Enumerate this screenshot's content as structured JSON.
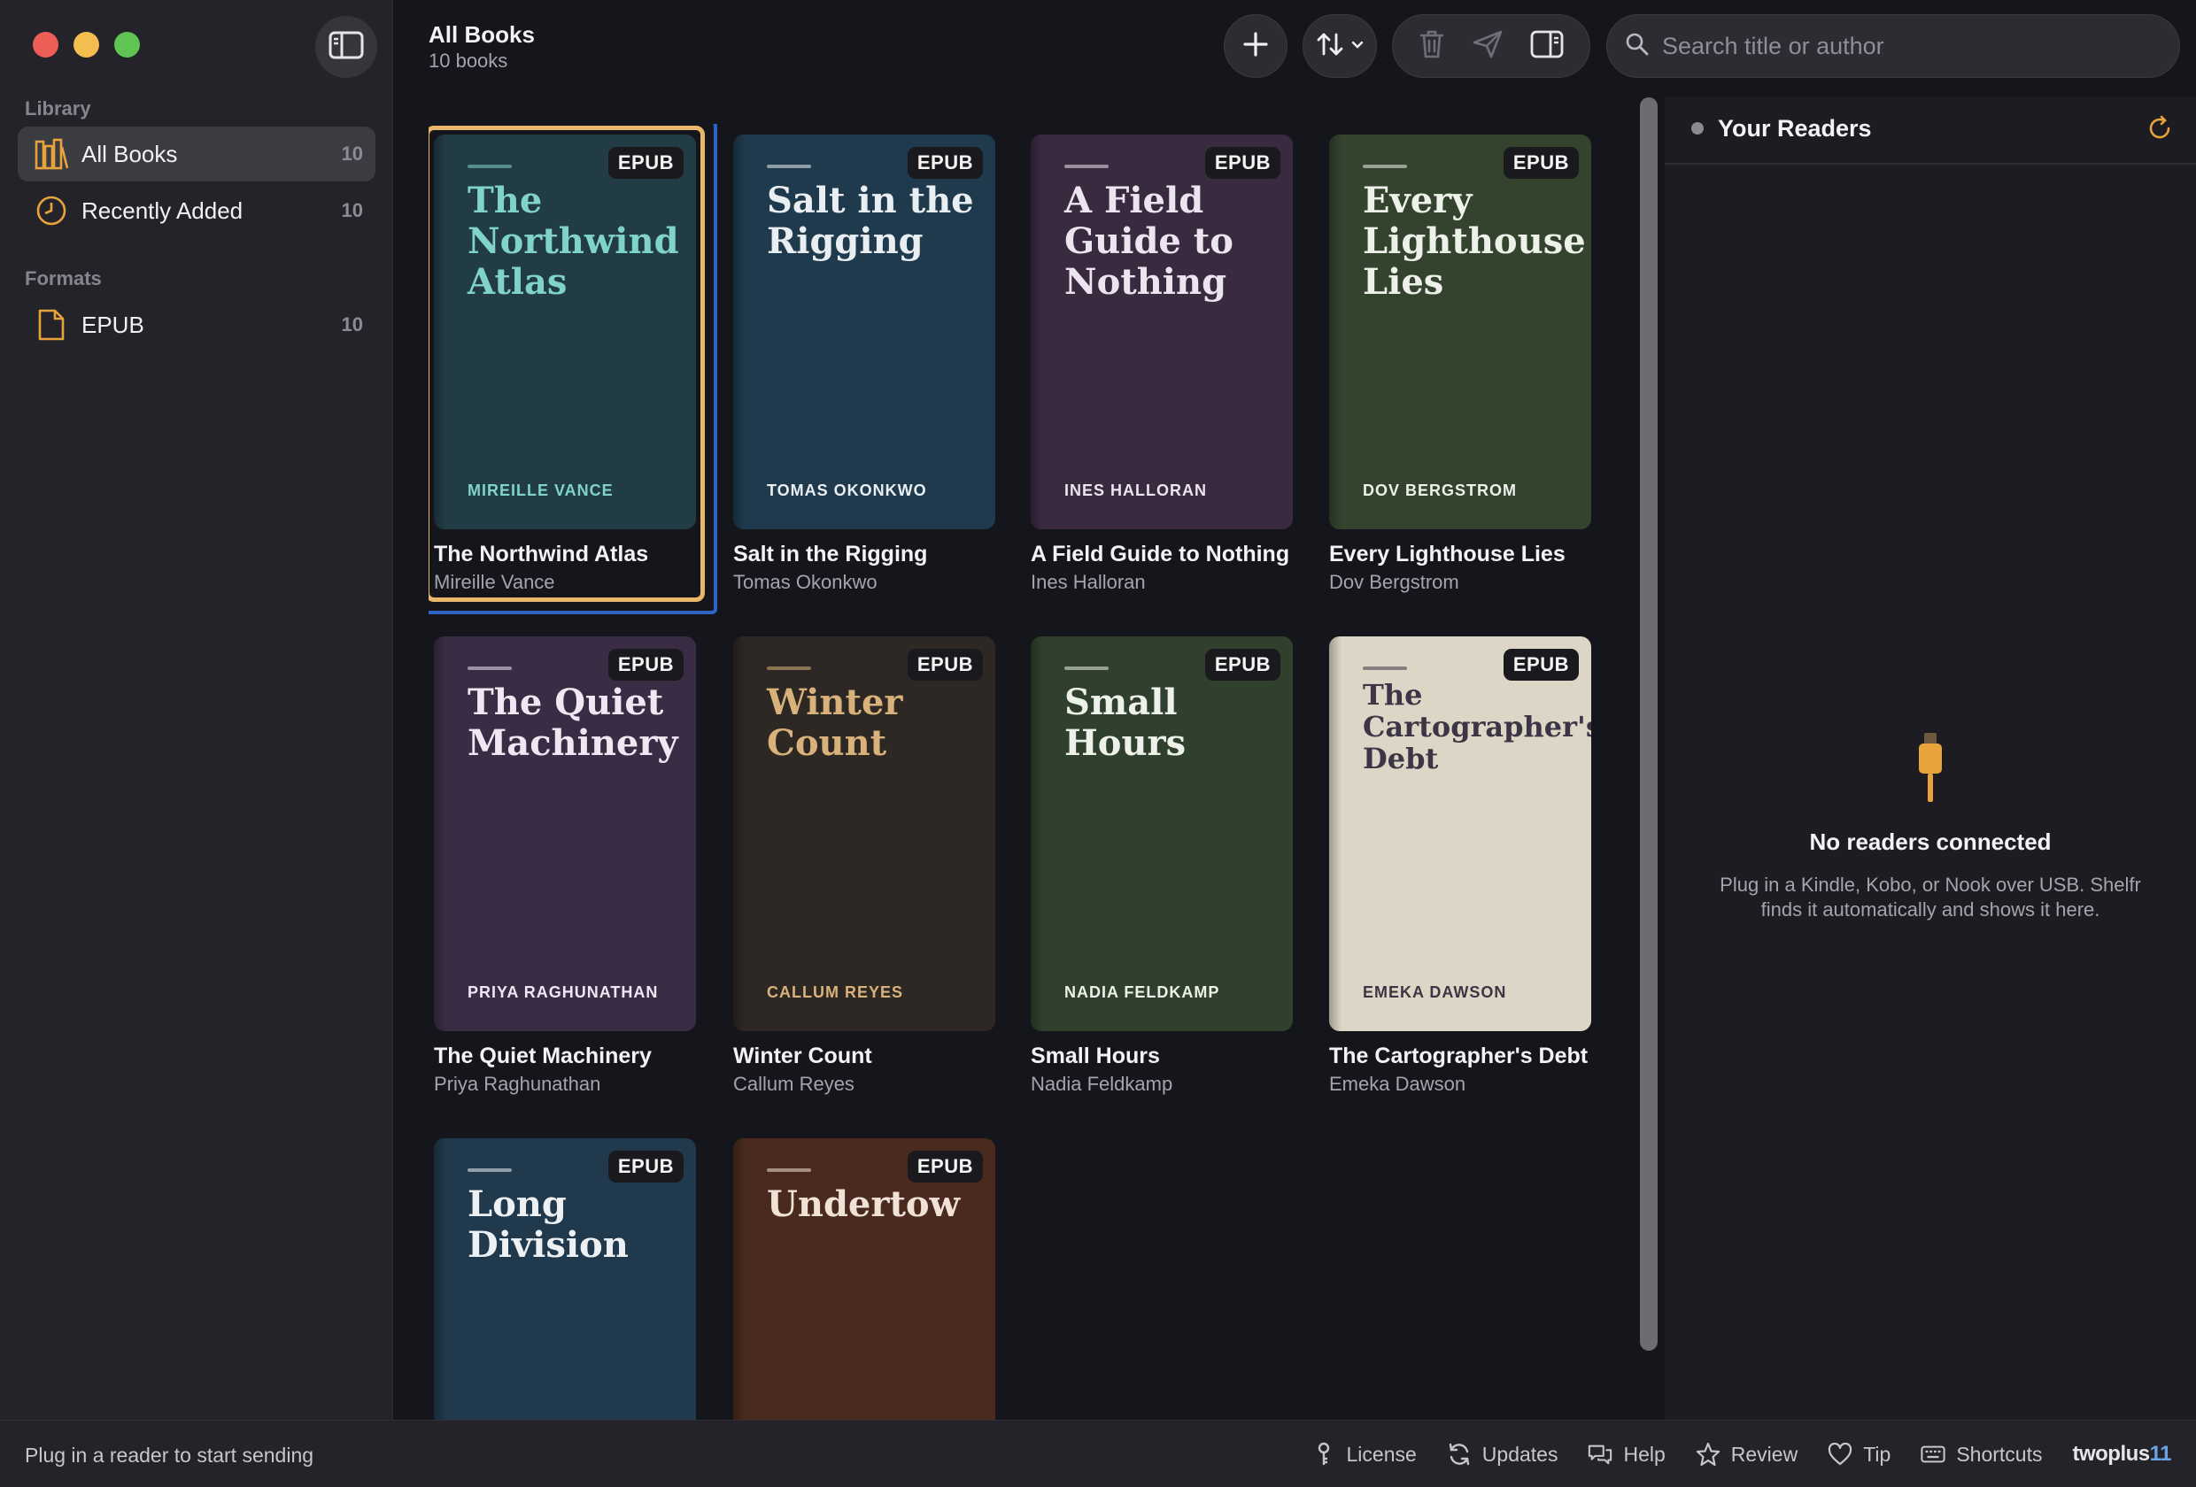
{
  "header": {
    "title": "All Books",
    "subtitle": "10 books",
    "search_placeholder": "Search title or author"
  },
  "sidebar": {
    "library_label": "Library",
    "formats_label": "Formats",
    "items": [
      {
        "label": "All Books",
        "count": "10"
      },
      {
        "label": "Recently Added",
        "count": "10"
      }
    ],
    "formats": [
      {
        "label": "EPUB",
        "count": "10"
      }
    ]
  },
  "books": [
    {
      "title": "The Northwind Atlas",
      "cover_title": "The Northwind Atlas",
      "author": "Mireille Vance",
      "cover_author": "MIREILLE VANCE",
      "format": "EPUB",
      "cover_bg": "#223c45",
      "accent": "#7fd3c8"
    },
    {
      "title": "Salt in the Rigging",
      "cover_title": "Salt in the Rigging",
      "author": "Tomas Okonkwo",
      "cover_author": "TOMAS OKONKWO",
      "format": "EPUB",
      "cover_bg": "#1f3a4d",
      "accent": "#e9eef3"
    },
    {
      "title": "A Field Guide to Nothing",
      "cover_title": "A Field Guide to Nothing",
      "author": "Ines Halloran",
      "cover_author": "INES HALLORAN",
      "format": "EPUB",
      "cover_bg": "#3a2a40",
      "accent": "#ece4ef"
    },
    {
      "title": "Every Lighthouse Lies",
      "cover_title": "Every Lighthouse Lies",
      "author": "Dov Bergstrom",
      "cover_author": "DOV BERGSTROM",
      "format": "EPUB",
      "cover_bg": "#33432e",
      "accent": "#eef1ea"
    },
    {
      "title": "The Quiet Machinery",
      "cover_title": "The Quiet Machinery",
      "author": "Priya Raghunathan",
      "cover_author": "PRIYA RAGHUNATHAN",
      "format": "EPUB",
      "cover_bg": "#3b2c45",
      "accent": "#efe7f2"
    },
    {
      "title": "Winter Count",
      "cover_title": "Winter Count",
      "author": "Callum Reyes",
      "cover_author": "CALLUM REYES",
      "format": "EPUB",
      "cover_bg": "#2e2824",
      "accent": "#d8b27a"
    },
    {
      "title": "Small Hours",
      "cover_title": "Small Hours",
      "author": "Nadia Feldkamp",
      "cover_author": "NADIA FELDKAMP",
      "format": "EPUB",
      "cover_bg": "#2f412d",
      "accent": "#eef1ea"
    },
    {
      "title": "The Cartographer's Debt",
      "cover_title": "The Cartographer's Debt",
      "author": "Emeka Dawson",
      "cover_author": "EMEKA DAWSON",
      "format": "EPUB",
      "cover_bg": "#ddd6c6",
      "accent": "#3c3545"
    },
    {
      "title": "",
      "cover_title": "Long Division",
      "author": "",
      "cover_author": "",
      "format": "EPUB",
      "cover_bg": "#21394c",
      "accent": "#eef1f4"
    },
    {
      "title": "",
      "cover_title": "Undertow",
      "author": "",
      "cover_author": "",
      "format": "EPUB",
      "cover_bg": "#4a2a1f",
      "accent": "#f0e2d6"
    }
  ],
  "readers_panel": {
    "title": "Your Readers",
    "empty_title": "No readers connected",
    "empty_desc": "Plug in a Kindle, Kobo, or Nook over USB. Shelfr finds it automatically and shows it here."
  },
  "statusbar": {
    "message": "Plug in a reader to start sending",
    "items": [
      {
        "label": "License",
        "icon": "key-icon"
      },
      {
        "label": "Updates",
        "icon": "refresh-icon"
      },
      {
        "label": "Help",
        "icon": "chat-bubbles-icon"
      },
      {
        "label": "Review",
        "icon": "star-icon"
      },
      {
        "label": "Tip",
        "icon": "heart-icon"
      },
      {
        "label": "Shortcuts",
        "icon": "keyboard-icon"
      }
    ],
    "brand_a": "twoplus",
    "brand_b": "11"
  },
  "colors": {
    "selection_blue": "#2d63c4",
    "selection_gold": "#e8b76a",
    "accent_orange": "#e8a33a"
  }
}
